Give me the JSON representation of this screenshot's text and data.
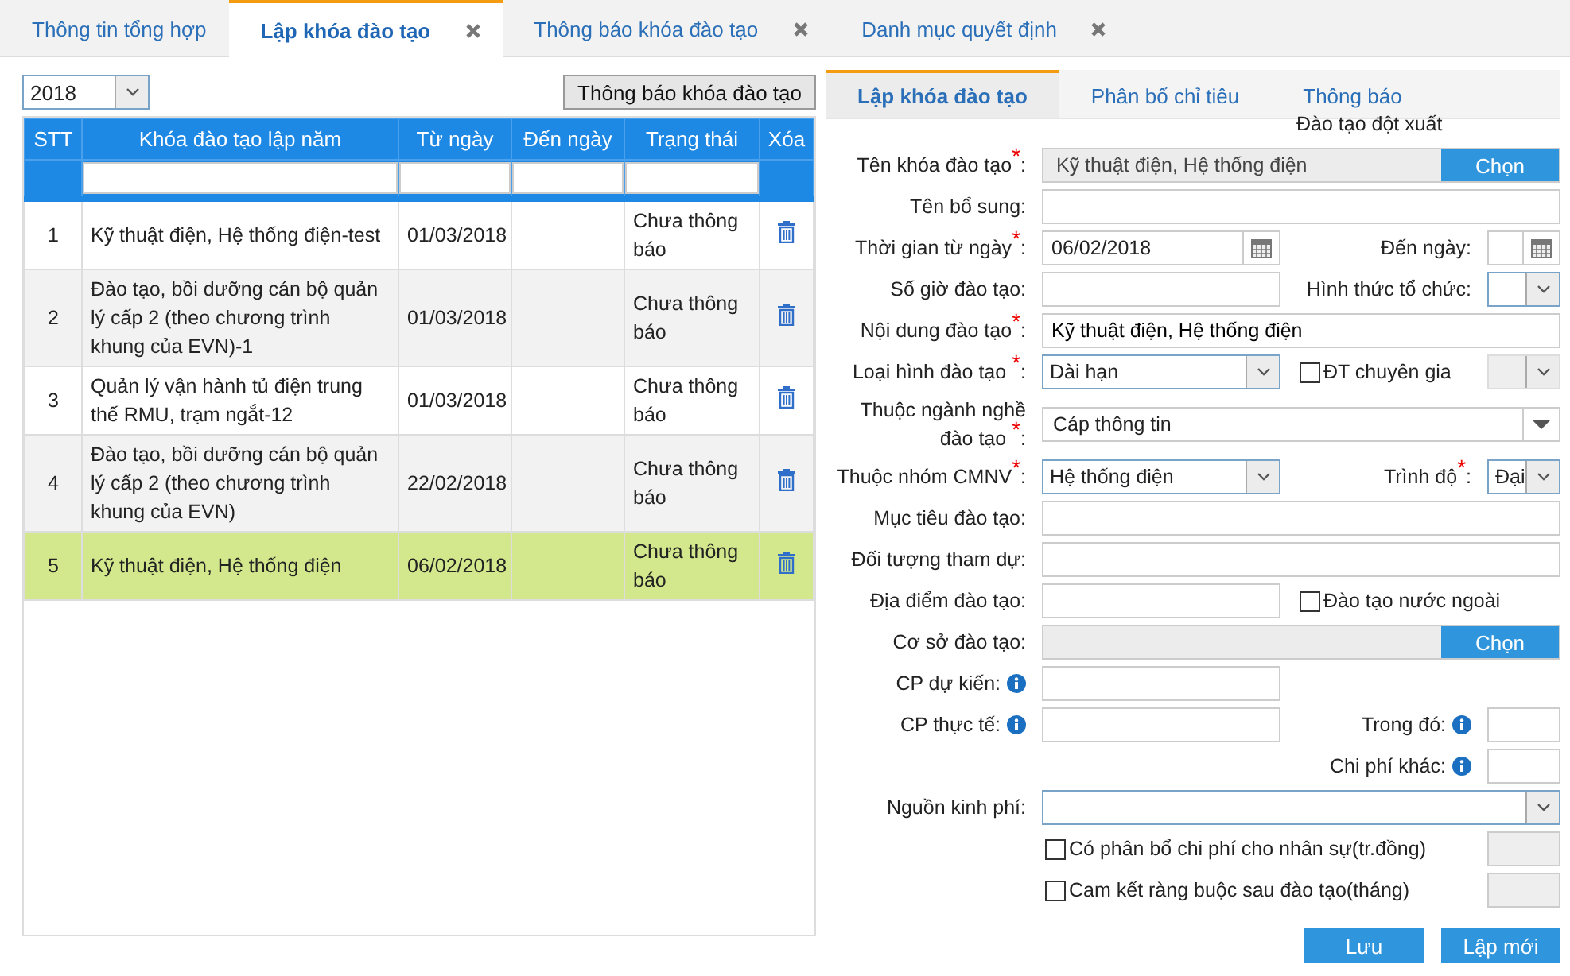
{
  "top_tabs": [
    {
      "label": "Thông tin tổng hợp",
      "selected": false,
      "closable": false
    },
    {
      "label": "Lập khóa đào tạo",
      "selected": true,
      "closable": true
    },
    {
      "label": "Thông báo khóa đào tạo",
      "selected": false,
      "closable": true
    },
    {
      "label": "Danh mục quyết định",
      "selected": false,
      "closable": true
    }
  ],
  "year_select": {
    "value": "2018"
  },
  "notify_button": "Thông báo khóa đào tạo",
  "table": {
    "columns": [
      "STT",
      "Khóa đào tạo lập năm",
      "Từ ngày",
      "Đến ngày",
      "Trạng thái",
      "Xóa"
    ],
    "rows": [
      {
        "stt": "1",
        "name": "Kỹ thuật điện, Hệ thống điện-test",
        "from": "01/03/2018",
        "status": "Chưa thông báo",
        "selected": false
      },
      {
        "stt": "2",
        "name": "Đào tạo, bồi dưỡng cán bộ quản lý cấp 2 (theo chương trình khung của EVN)-1",
        "from": "01/03/2018",
        "status": "Chưa thông báo",
        "selected": false
      },
      {
        "stt": "3",
        "name": "Quản lý vận hành tủ điện trung thế RMU, trạm ngắt-12",
        "from": "01/03/2018",
        "status": "Chưa thông báo",
        "selected": false
      },
      {
        "stt": "4",
        "name": "Đào tạo, bồi dưỡng cán bộ quản lý cấp 2 (theo chương trình khung của EVN)",
        "from": "22/02/2018",
        "status": "Chưa thông báo",
        "selected": false
      },
      {
        "stt": "5",
        "name": "Kỹ thuật điện, Hệ thống điện",
        "from": "06/02/2018",
        "status": "Chưa thông báo",
        "selected": true
      }
    ]
  },
  "form": {
    "tabs": [
      {
        "label": "Lập khóa đào tạo",
        "selected": true
      },
      {
        "label": "Phân bổ chỉ tiêu",
        "selected": false
      },
      {
        "label": "Thông báo",
        "selected": false
      }
    ],
    "note": "Đào tạo đột xuất",
    "rows": [
      {
        "label": "Tên khóa đào tạo$^{*}$:",
        "main": {
          "kind": "picker",
          "value": "Kỹ thuật điện, Hệ thống điện",
          "button": "Chọn"
        }
      },
      {
        "label": "Tên bổ sung:",
        "main": {
          "kind": "text"
        }
      },
      {
        "label": "Thời gian từ ngày$^{*}$:",
        "main": {
          "kind": "date",
          "value": "06/02/2018"
        },
        "side": [
          {
            "kind": "label",
            "text": "Đến ngày:"
          },
          {
            "kind": "date"
          }
        ]
      },
      {
        "label": "Số giờ đào tạo:",
        "main": {
          "kind": "text"
        },
        "side": [
          {
            "kind": "label",
            "text": "Hình thức tổ chức:"
          },
          {
            "kind": "select",
            "disabled": false
          }
        ]
      },
      {
        "label": "Nội dung đào tạo$^{*}$:",
        "main": {
          "kind": "text",
          "value": "Kỹ thuật điện, Hệ thống điện"
        }
      },
      {
        "label": "Loại hình đào tạo $^{*}$:",
        "main": {
          "kind": "select",
          "value": "Dài hạn",
          "disabled": false
        },
        "side": [
          {
            "kind": "checkbox",
            "label": "ĐT chuyên gia",
            "checked": false
          },
          {
            "kind": "select",
            "disabled": true
          }
        ]
      },
      {
        "label": "Thuộc ngành nghề đào tạo $^{*}$:",
        "main": {
          "kind": "combo",
          "value": "Cáp thông tin"
        }
      },
      {
        "label": "Thuộc nhóm CMNV$^{*}$:",
        "main": {
          "kind": "select",
          "value": "Hệ thống điện",
          "disabled": false
        },
        "side": [
          {
            "kind": "label",
            "text": "Trình độ$^{*}$:"
          },
          {
            "kind": "select",
            "value": "Đại",
            "disabled": false
          }
        ]
      },
      {
        "label": "Mục tiêu đào tạo:",
        "main": {
          "kind": "text"
        }
      },
      {
        "label": "Đối tượng tham dự:",
        "main": {
          "kind": "text"
        }
      },
      {
        "label": "Địa điểm đào tạo:",
        "main": {
          "kind": "text"
        },
        "side": [
          {
            "kind": "checkbox",
            "label": "Đào tạo nước ngoài",
            "checked": false
          }
        ]
      },
      {
        "label": "Cơ sở đào tạo:",
        "main": {
          "kind": "picker",
          "button": "Chọn"
        }
      },
      {
        "label": "CP dự kiến:",
        "info": true,
        "main": {
          "kind": "text"
        },
        "side": []
      },
      {
        "label": "CP thực tế:",
        "info": true,
        "main": {
          "kind": "text"
        },
        "side": [
          {
            "kind": "label",
            "text": "Trong đó:",
            "info": true
          },
          {
            "kind": "text",
            "disabled": false
          }
        ]
      },
      {
        "side": [
          {
            "kind": "label",
            "text": "Chi phí khác:",
            "info": true
          },
          {
            "kind": "text",
            "disabled": false
          }
        ]
      },
      {
        "label": "Nguồn kinh phí:",
        "main": {
          "kind": "select",
          "disabled": false
        }
      },
      {
        "main": {
          "kind": "checkbox",
          "label": "Có phân bổ chi phí cho nhân sự(tr.đồng)",
          "checked": false
        },
        "side": [
          {
            "kind": "text",
            "disabled": true
          }
        ]
      },
      {
        "main": {
          "kind": "checkbox",
          "label": "Cam kết ràng buộc sau đào tạo(tháng)",
          "checked": false
        },
        "side": [
          {
            "kind": "text",
            "disabled": true
          }
        ]
      }
    ],
    "buttons": [
      "Lưu",
      "Lập mới"
    ]
  }
}
